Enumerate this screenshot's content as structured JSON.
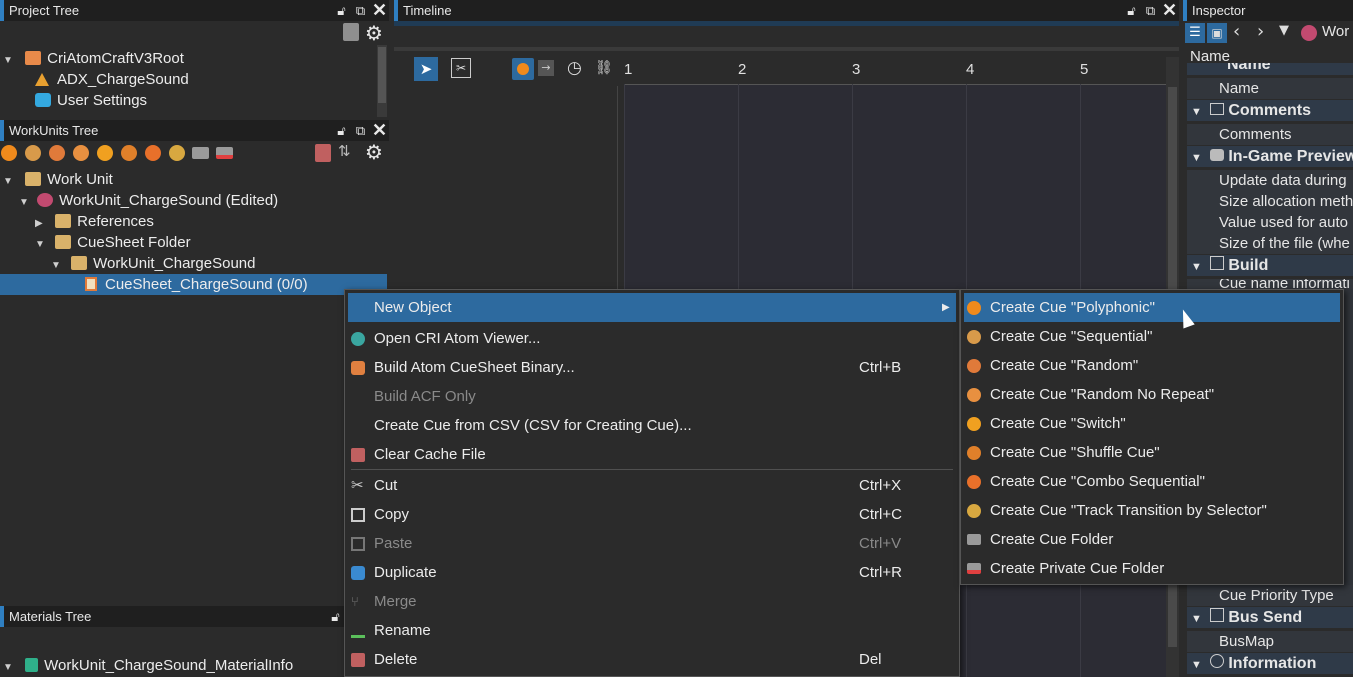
{
  "project_tree": {
    "title": "Project Tree",
    "items": [
      "CriAtomCraftV3Root",
      "ADX_ChargeSound",
      "User Settings"
    ]
  },
  "workunits_tree": {
    "title": "WorkUnits Tree",
    "items": [
      "Work Unit",
      "WorkUnit_ChargeSound (Edited)",
      "References",
      "CueSheet Folder",
      "WorkUnit_ChargeSound",
      "CueSheet_ChargeSound (0/0)"
    ]
  },
  "materials_tree": {
    "title": "Materials Tree",
    "items": [
      "WorkUnit_ChargeSound_MaterialInfo"
    ]
  },
  "timeline": {
    "title": "Timeline",
    "ruler": [
      "1",
      "2",
      "3",
      "4",
      "5"
    ]
  },
  "inspector": {
    "title": "Inspector",
    "workunit_label": "Wor",
    "column_header": "Name",
    "rows": [
      "Name",
      "Comments",
      "Comments",
      "In-Game Preview",
      "Update data during",
      "Size allocation meth",
      "Value used for auto",
      "Size of the file (whe",
      "Build",
      "Cue name informati",
      "Cue Priority Type",
      "Bus Send",
      "BusMap",
      "Information"
    ]
  },
  "context_menu": {
    "items": [
      {
        "label": "New Object",
        "shortcut": ""
      },
      {
        "label": "Open CRI Atom Viewer...",
        "shortcut": ""
      },
      {
        "label": "Build Atom CueSheet Binary...",
        "shortcut": "Ctrl+B"
      },
      {
        "label": "Build ACF Only",
        "shortcut": ""
      },
      {
        "label": "Create Cue from CSV (CSV for Creating Cue)...",
        "shortcut": ""
      },
      {
        "label": "Clear Cache File",
        "shortcut": ""
      },
      {
        "label": "Cut",
        "shortcut": "Ctrl+X"
      },
      {
        "label": "Copy",
        "shortcut": "Ctrl+C"
      },
      {
        "label": "Paste",
        "shortcut": "Ctrl+V"
      },
      {
        "label": "Duplicate",
        "shortcut": "Ctrl+R"
      },
      {
        "label": "Merge",
        "shortcut": ""
      },
      {
        "label": "Rename",
        "shortcut": ""
      },
      {
        "label": "Delete",
        "shortcut": "Del"
      }
    ]
  },
  "submenu": {
    "items": [
      "Create Cue \"Polyphonic\"",
      "Create Cue \"Sequential\"",
      "Create Cue \"Random\"",
      "Create Cue \"Random No Repeat\"",
      "Create Cue \"Switch\"",
      "Create Cue \"Shuffle Cue\"",
      "Create Cue \"Combo Sequential\"",
      "Create Cue \"Track Transition by Selector\"",
      "Create Cue Folder",
      "Create Private Cue Folder"
    ]
  },
  "colors": {
    "accent": "#2f7fc1",
    "selection": "#2d6a9f",
    "panel_bg": "#2b2b2b"
  }
}
